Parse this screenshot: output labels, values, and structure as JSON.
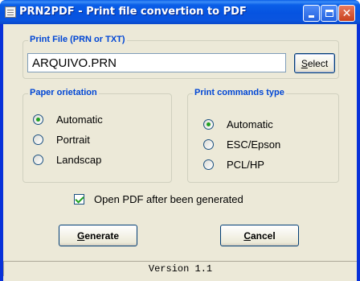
{
  "window": {
    "title": "PRN2PDF - Print file convertion to PDF",
    "controls": {
      "minimize": "minimize-icon",
      "maximize": "maximize-icon",
      "close": "close-icon"
    }
  },
  "print_file": {
    "legend": "Print File (PRN or TXT)",
    "value": "ARQUIVO.PRN",
    "select_label_access": "S",
    "select_label_rest": "elect"
  },
  "paper_orientation": {
    "legend": "Paper orietation",
    "options": [
      {
        "label": "Automatic",
        "checked": true
      },
      {
        "label": "Portrait",
        "checked": false
      },
      {
        "label": "Landscap",
        "checked": false
      }
    ]
  },
  "print_commands": {
    "legend": "Print commands type",
    "options": [
      {
        "label": "Automatic",
        "checked": true
      },
      {
        "label": "ESC/Epson",
        "checked": false
      },
      {
        "label": "PCL/HP",
        "checked": false
      }
    ]
  },
  "open_pdf": {
    "label": "Open PDF after been generated",
    "checked": true
  },
  "buttons": {
    "generate_access": "G",
    "generate_rest": "enerate",
    "cancel_access": "C",
    "cancel_rest": "ancel"
  },
  "status": {
    "version": "Version 1.1"
  },
  "colors": {
    "legend": "#0046d5",
    "accent_check": "#21a121",
    "titlebar": "#0653e0"
  }
}
